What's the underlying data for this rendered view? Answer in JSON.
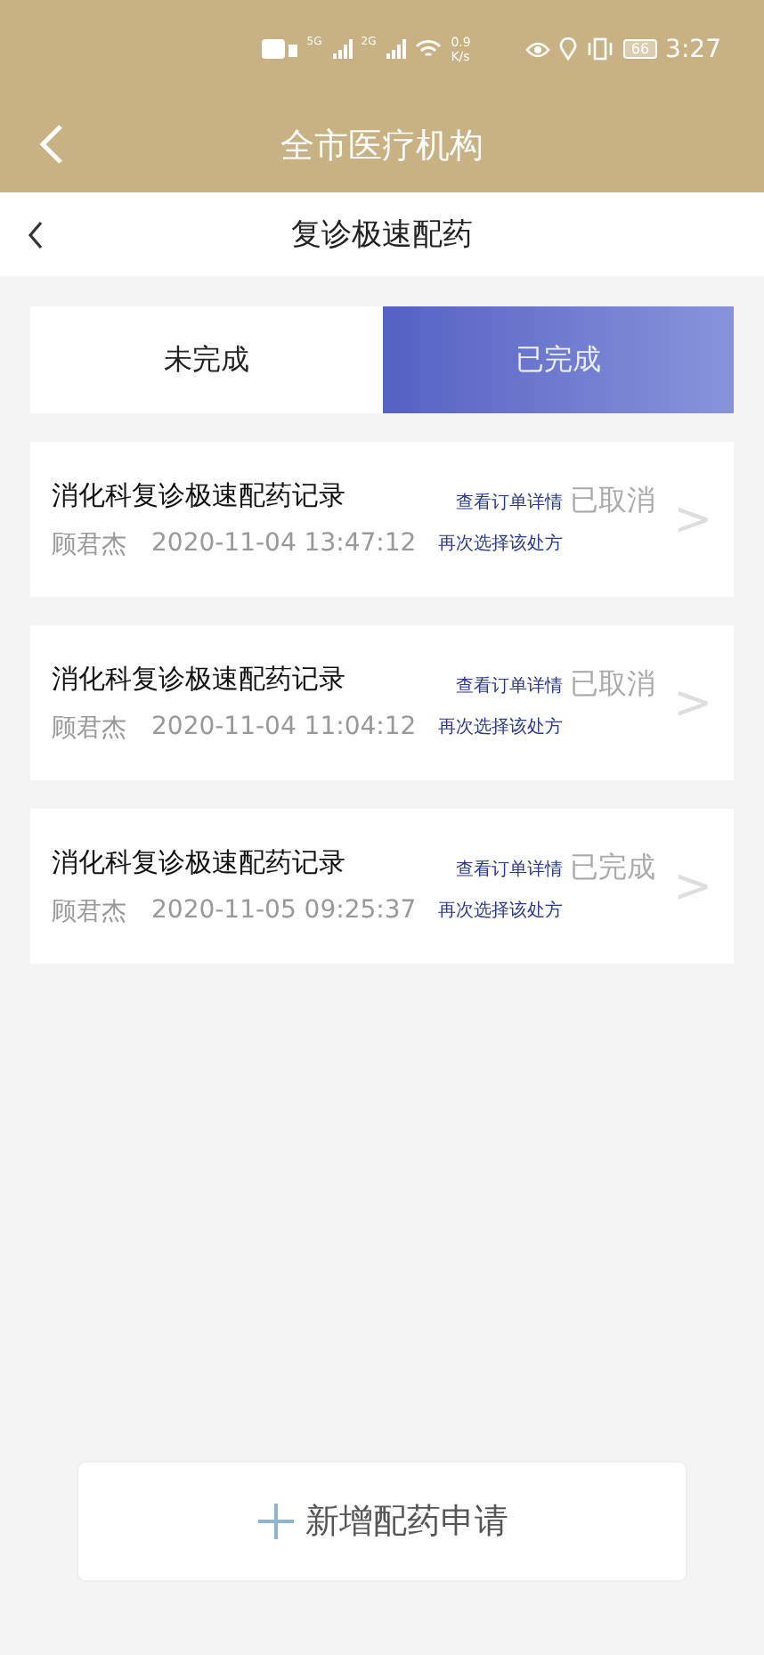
{
  "status_bar": {
    "network_5g": "5G",
    "network_2g": "2G",
    "speed_value": "0.9",
    "speed_unit": "K/s",
    "battery": "66",
    "time": "3:27"
  },
  "header": {
    "title": "全市医疗机构"
  },
  "sub_header": {
    "title": "复诊极速配药"
  },
  "tabs": [
    {
      "label": "未完成",
      "selected": false
    },
    {
      "label": "已完成",
      "selected": true
    }
  ],
  "records": [
    {
      "title": "消化科复诊极速配药记录",
      "patient": "顾君杰",
      "time": "2020-11-04 13:47:12",
      "detail_link": "查看订单详情",
      "status": "已取消",
      "reselect_link": "再次选择该处方",
      "chevron": ">"
    },
    {
      "title": "消化科复诊极速配药记录",
      "patient": "顾君杰",
      "time": "2020-11-04 11:04:12",
      "detail_link": "查看订单详情",
      "status": "已取消",
      "reselect_link": "再次选择该处方",
      "chevron": ">"
    },
    {
      "title": "消化科复诊极速配药记录",
      "patient": "顾君杰",
      "time": "2020-11-05 09:25:37",
      "detail_link": "查看订单详情",
      "status": "已完成",
      "reselect_link": "再次选择该处方",
      "chevron": ">"
    }
  ],
  "add_button": {
    "label": "新增配药申请"
  }
}
